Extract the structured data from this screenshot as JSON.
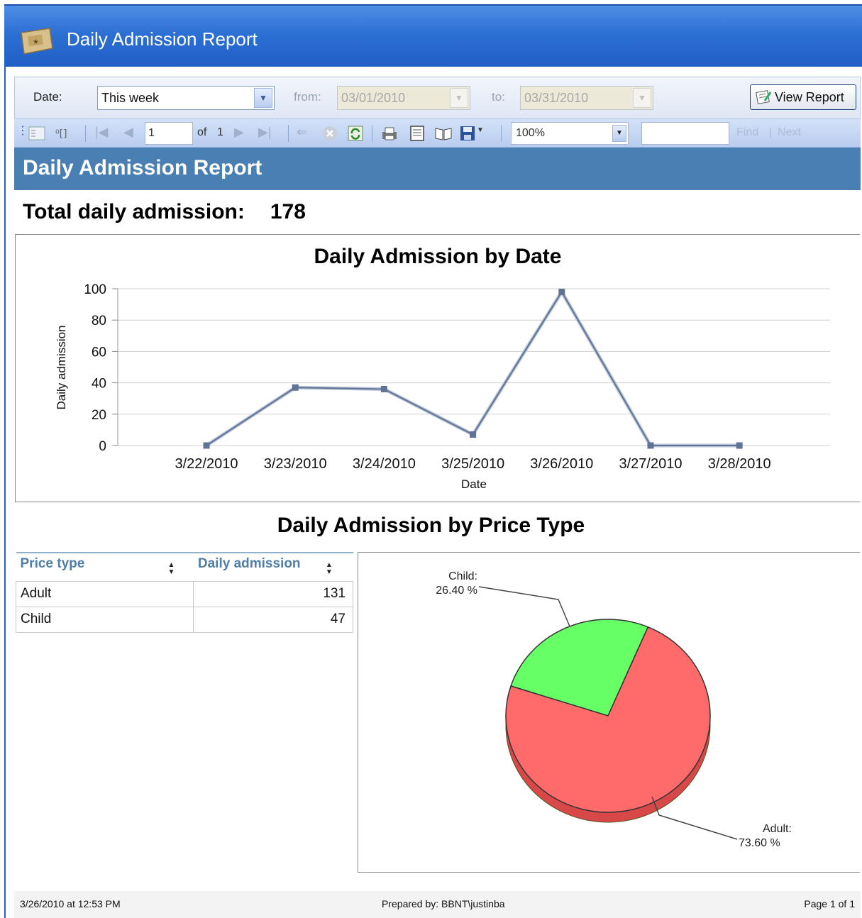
{
  "window": {
    "title": "Daily Admission Report"
  },
  "params": {
    "date_label": "Date:",
    "date_value": "This week",
    "from_label": "from:",
    "from_value": "03/01/2010",
    "to_label": "to:",
    "to_value": "03/31/2010",
    "view_report_label": "View Report"
  },
  "toolbar": {
    "page_current": "1",
    "page_of_label": "of",
    "page_total": "1",
    "zoom": "100%",
    "find_label": "Find",
    "next_label": "Next",
    "find_value": ""
  },
  "report": {
    "header": "Daily Admission Report",
    "total_label": "Total daily admission:",
    "total_value": "178",
    "section_title": "Daily Admission by Price Type"
  },
  "table": {
    "columns": [
      "Price type",
      "Daily admission"
    ],
    "rows": [
      {
        "type": "Adult",
        "value": "131"
      },
      {
        "type": "Child",
        "value": "47"
      }
    ]
  },
  "chart_data": [
    {
      "type": "line",
      "title": "Daily Admission by Date",
      "xlabel": "Date",
      "ylabel": "Daily admission",
      "categories": [
        "3/22/2010",
        "3/23/2010",
        "3/24/2010",
        "3/25/2010",
        "3/26/2010",
        "3/27/2010",
        "3/28/2010"
      ],
      "values": [
        0,
        37,
        36,
        7,
        98,
        0,
        0
      ],
      "ylim": [
        0,
        100
      ],
      "yticks": [
        "0",
        "20",
        "40",
        "60",
        "80",
        "100"
      ],
      "grid": true,
      "color": "#5f7397"
    },
    {
      "type": "pie",
      "labels": [
        "Child",
        "Adult"
      ],
      "values": [
        26.4,
        73.6
      ],
      "label_text": [
        "Child:",
        "Adult:"
      ],
      "percent_text": [
        "26.40 %",
        "73.60 %"
      ],
      "colors": [
        "#66ff66",
        "#ff6a6a"
      ]
    }
  ],
  "footer": {
    "timestamp": "3/26/2010 at 12:53 PM",
    "prepared_by": "Prepared by: BBNT\\justinba",
    "page": "Page 1 of 1"
  }
}
